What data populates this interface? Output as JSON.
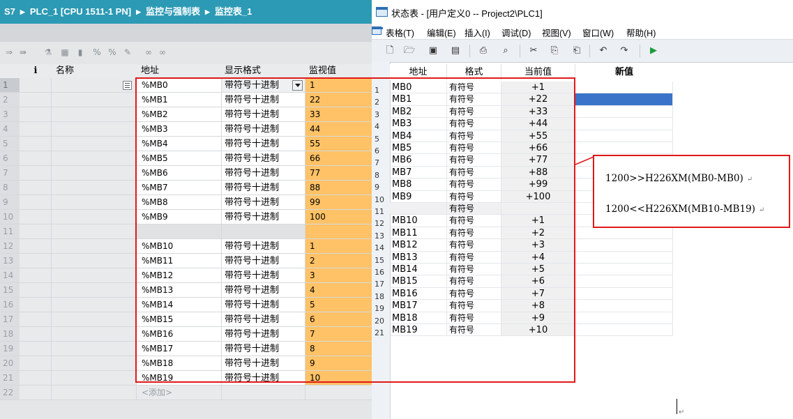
{
  "tia": {
    "breadcrumb": [
      "S7",
      "PLC_1 [CPU 1511-1 PN]",
      "监控与强制表",
      "监控表_1"
    ],
    "headers": {
      "info": "i",
      "name": "名称",
      "address": "地址",
      "format": "显示格式",
      "monitor": "监视值"
    },
    "rows": [
      {
        "index": "1",
        "address": "%MB0",
        "format": "带符号十进制",
        "value": "1"
      },
      {
        "index": "2",
        "address": "%MB1",
        "format": "带符号十进制",
        "value": "22"
      },
      {
        "index": "3",
        "address": "%MB2",
        "format": "带符号十进制",
        "value": "33"
      },
      {
        "index": "4",
        "address": "%MB3",
        "format": "带符号十进制",
        "value": "44"
      },
      {
        "index": "5",
        "address": "%MB4",
        "format": "带符号十进制",
        "value": "55"
      },
      {
        "index": "6",
        "address": "%MB5",
        "format": "带符号十进制",
        "value": "66"
      },
      {
        "index": "7",
        "address": "%MB6",
        "format": "带符号十进制",
        "value": "77"
      },
      {
        "index": "8",
        "address": "%MB7",
        "format": "带符号十进制",
        "value": "88"
      },
      {
        "index": "9",
        "address": "%MB8",
        "format": "带符号十进制",
        "value": "99"
      },
      {
        "index": "10",
        "address": "%MB9",
        "format": "带符号十进制",
        "value": "100"
      },
      {
        "index": "11",
        "address": "",
        "format": "",
        "value": ""
      },
      {
        "index": "12",
        "address": "%MB10",
        "format": "带符号十进制",
        "value": "1"
      },
      {
        "index": "13",
        "address": "%MB11",
        "format": "带符号十进制",
        "value": "2"
      },
      {
        "index": "14",
        "address": "%MB12",
        "format": "带符号十进制",
        "value": "3"
      },
      {
        "index": "15",
        "address": "%MB13",
        "format": "带符号十进制",
        "value": "4"
      },
      {
        "index": "16",
        "address": "%MB14",
        "format": "带符号十进制",
        "value": "5"
      },
      {
        "index": "17",
        "address": "%MB15",
        "format": "带符号十进制",
        "value": "6"
      },
      {
        "index": "18",
        "address": "%MB16",
        "format": "带符号十进制",
        "value": "7"
      },
      {
        "index": "19",
        "address": "%MB17",
        "format": "带符号十进制",
        "value": "8"
      },
      {
        "index": "20",
        "address": "%MB18",
        "format": "带符号十进制",
        "value": "9"
      },
      {
        "index": "21",
        "address": "%MB19",
        "format": "带符号十进制",
        "value": "10"
      },
      {
        "index": "22",
        "address": "<添加>",
        "format": "",
        "value": ""
      }
    ]
  },
  "status_window": {
    "title": "状态表 - [用户定义0 -- Project2\\PLC1]",
    "menu": [
      "表格(T)",
      "编辑(E)",
      "插入(I)",
      "调试(D)",
      "视图(V)",
      "窗口(W)",
      "帮助(H)"
    ],
    "headers": {
      "address": "地址",
      "format": "格式",
      "current": "当前值",
      "new": "新值"
    },
    "rows": [
      {
        "index": "1",
        "address": "MB0",
        "format": "有符号",
        "current": "+1"
      },
      {
        "index": "2",
        "address": "MB1",
        "format": "有符号",
        "current": "+22"
      },
      {
        "index": "3",
        "address": "MB2",
        "format": "有符号",
        "current": "+33"
      },
      {
        "index": "4",
        "address": "MB3",
        "format": "有符号",
        "current": "+44"
      },
      {
        "index": "5",
        "address": "MB4",
        "format": "有符号",
        "current": "+55"
      },
      {
        "index": "6",
        "address": "MB5",
        "format": "有符号",
        "current": "+66"
      },
      {
        "index": "7",
        "address": "MB6",
        "format": "有符号",
        "current": "+77"
      },
      {
        "index": "8",
        "address": "MB7",
        "format": "有符号",
        "current": "+88"
      },
      {
        "index": "9",
        "address": "MB8",
        "format": "有符号",
        "current": "+99"
      },
      {
        "index": "10",
        "address": "MB9",
        "format": "有符号",
        "current": "+100"
      },
      {
        "index": "11",
        "address": "",
        "format": "有符号",
        "current": ""
      },
      {
        "index": "12",
        "address": "MB10",
        "format": "有符号",
        "current": "+1"
      },
      {
        "index": "13",
        "address": "MB11",
        "format": "有符号",
        "current": "+2"
      },
      {
        "index": "14",
        "address": "MB12",
        "format": "有符号",
        "current": "+3"
      },
      {
        "index": "15",
        "address": "MB13",
        "format": "有符号",
        "current": "+4"
      },
      {
        "index": "16",
        "address": "MB14",
        "format": "有符号",
        "current": "+5"
      },
      {
        "index": "17",
        "address": "MB15",
        "format": "有符号",
        "current": "+6"
      },
      {
        "index": "18",
        "address": "MB16",
        "format": "有符号",
        "current": "+7"
      },
      {
        "index": "19",
        "address": "MB17",
        "format": "有符号",
        "current": "+8"
      },
      {
        "index": "20",
        "address": "MB18",
        "format": "有符号",
        "current": "+9"
      },
      {
        "index": "21",
        "address": "MB19",
        "format": "有符号",
        "current": "+10"
      }
    ]
  },
  "annotation": {
    "line1": "1200>>H226XM(MB0-MB0)",
    "line2": "1200<<H226XM(MB10-MB19)",
    "return_mark": "↵"
  },
  "colors": {
    "tia_title_bg": "#2c9ab4",
    "monitor_bg": "#ffc266",
    "highlight_red": "#e01818",
    "selection_blue": "#3a74c9"
  }
}
